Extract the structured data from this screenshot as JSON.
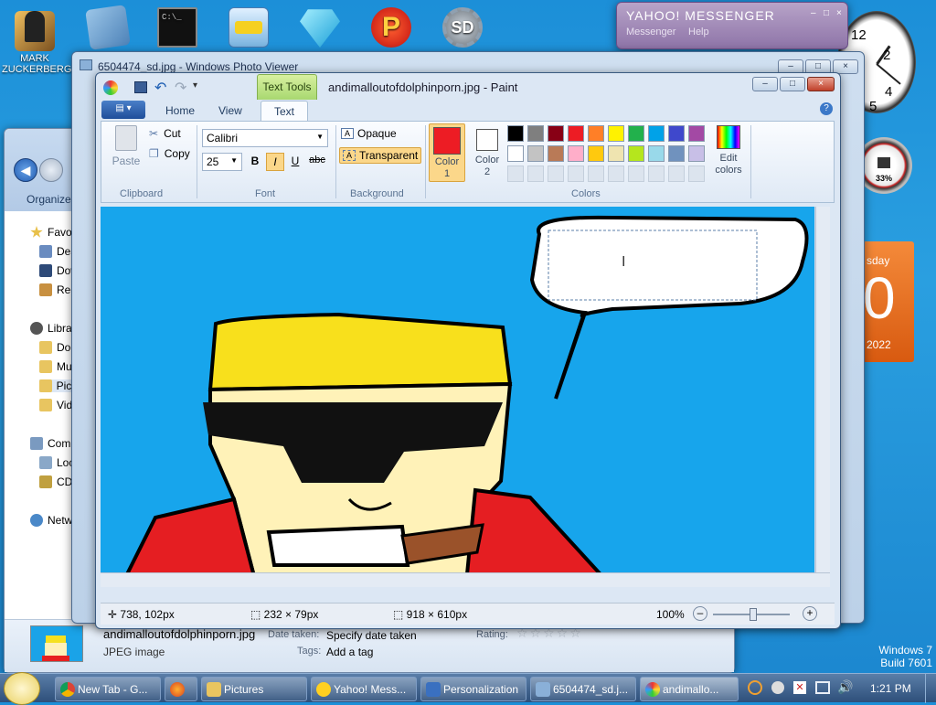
{
  "desktop": {
    "icons": [
      {
        "label": "MARK\nZUCKERBERG"
      }
    ],
    "watermark": {
      "line1": "Windows 7",
      "line2": "Build 7601"
    },
    "calendar": {
      "day": "sday",
      "date": "0",
      "year": "2022"
    },
    "gauge": {
      "percent": "33%"
    }
  },
  "messenger": {
    "title": "YAHOO! MESSENGER",
    "menu": [
      "Messenger",
      "Help"
    ]
  },
  "photo_viewer": {
    "title": "6504474_sd.jpg - Windows Photo Viewer"
  },
  "paint": {
    "title": "andimalloutofdolphinporn.jpg - Paint",
    "context_tab": "Text Tools",
    "tabs": [
      "Home",
      "View",
      "Text"
    ],
    "clipboard": {
      "paste": "Paste",
      "cut": "Cut",
      "copy": "Copy",
      "label": "Clipboard"
    },
    "font": {
      "family": "Calibri",
      "size": "25",
      "bold": "B",
      "italic": "I",
      "underline": "U",
      "strike": "abc",
      "label": "Font"
    },
    "background": {
      "opaque": "Opaque",
      "transparent": "Transparent",
      "label": "Background"
    },
    "colors": {
      "color1": "Color 1",
      "color2": "Color 2",
      "edit": "Edit colors",
      "label": "Colors",
      "color1_value": "#ed1c24",
      "color2_value": "#ffffff",
      "palette_row1": [
        "#000000",
        "#7f7f7f",
        "#880015",
        "#ed1c24",
        "#ff7f27",
        "#fff200",
        "#22b14c",
        "#00a2e8",
        "#3f48cc",
        "#a349a4"
      ],
      "palette_row2": [
        "#ffffff",
        "#c3c3c3",
        "#b97a57",
        "#ffaec9",
        "#ffc90e",
        "#efe4b0",
        "#b5e61d",
        "#99d9ea",
        "#7092be",
        "#c8bfe7"
      ]
    },
    "status": {
      "cursor": "738, 102px",
      "selection": "232 × 79px",
      "size": "918 × 610px",
      "zoom": "100%"
    }
  },
  "explorer": {
    "organize": "Organize",
    "nav": [
      {
        "label": "Favorites"
      },
      {
        "label": "Desktop"
      },
      {
        "label": "Downlo"
      },
      {
        "label": "Recent"
      },
      {
        "label": "Libraries"
      },
      {
        "label": "Docum"
      },
      {
        "label": "Music"
      },
      {
        "label": "Pictures"
      },
      {
        "label": "Videos"
      },
      {
        "label": "Compute"
      },
      {
        "label": "Local D"
      },
      {
        "label": "CD Driv"
      },
      {
        "label": "Network"
      }
    ],
    "details": {
      "filename": "andimalloutofdolphinporn.jpg",
      "type": "JPEG image",
      "date_label": "Date taken:",
      "date_value": "Specify date taken",
      "tags_label": "Tags:",
      "tags_value": "Add a tag",
      "rating_label": "Rating:"
    }
  },
  "taskbar": {
    "items": [
      {
        "label": "New Tab - G..."
      },
      {
        "label": ""
      },
      {
        "label": "Pictures"
      },
      {
        "label": "Yahoo! Mess..."
      },
      {
        "label": "Personalization"
      },
      {
        "label": "6504474_sd.j..."
      },
      {
        "label": "andimallo..."
      }
    ],
    "clock": "1:21 PM"
  }
}
